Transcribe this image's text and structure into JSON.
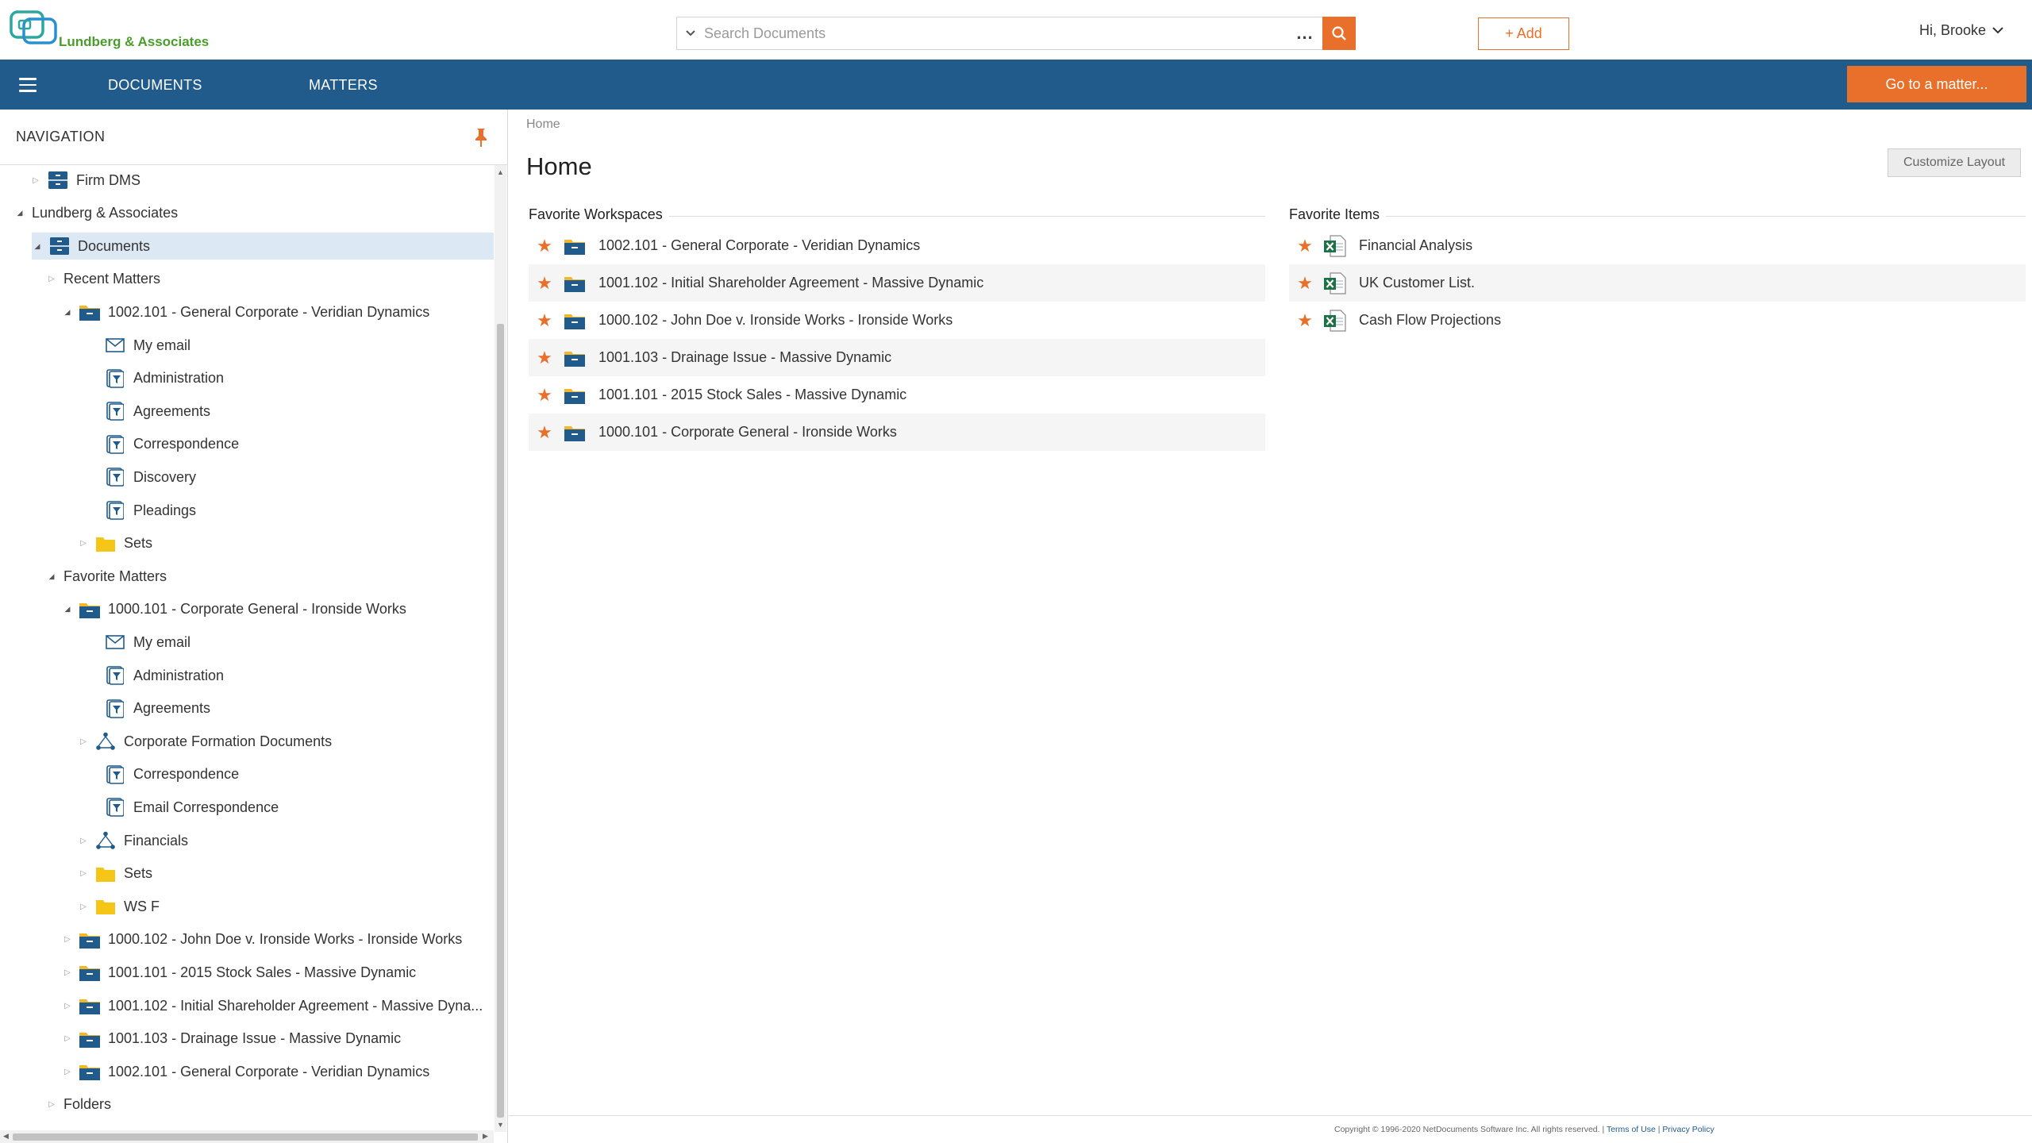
{
  "app": {
    "logo_text": "Lundberg & Associates",
    "accent": "#e8702a",
    "nav_color": "#215b8b"
  },
  "search": {
    "placeholder": "Search Documents",
    "more": "..."
  },
  "header": {
    "add_label": "+ Add",
    "user_greeting": "Hi, Brooke"
  },
  "navbar": {
    "documents": "DOCUMENTS",
    "matters": "MATTERS",
    "goto": "Go to a matter..."
  },
  "nav": {
    "title": "NAVIGATION",
    "tree": [
      {
        "label": "Firm DMS",
        "icon": "cabinet",
        "indent": 1,
        "toggle": "collapsed"
      },
      {
        "label": "Lundberg & Associates",
        "icon": "",
        "indent": 0,
        "toggle": "expanded"
      },
      {
        "label": "Documents",
        "icon": "cabinet",
        "indent": 1,
        "toggle": "expanded",
        "selected": true
      },
      {
        "label": "Recent Matters",
        "icon": "",
        "indent": 2,
        "toggle": "collapsed"
      },
      {
        "label": "1002.101 - General Corporate - Veridian Dynamics",
        "icon": "workspace",
        "indent": 3,
        "toggle": "expanded"
      },
      {
        "label": "My email",
        "icon": "email",
        "indent": 4,
        "toggle": ""
      },
      {
        "label": "Administration",
        "icon": "filter",
        "indent": 4,
        "toggle": ""
      },
      {
        "label": "Agreements",
        "icon": "filter",
        "indent": 4,
        "toggle": ""
      },
      {
        "label": "Correspondence",
        "icon": "filter",
        "indent": 4,
        "toggle": ""
      },
      {
        "label": "Discovery",
        "icon": "filter",
        "indent": 4,
        "toggle": ""
      },
      {
        "label": "Pleadings",
        "icon": "filter",
        "indent": 4,
        "toggle": ""
      },
      {
        "label": "Sets",
        "icon": "folder",
        "indent": 4,
        "toggle": "collapsed"
      },
      {
        "label": "Favorite Matters",
        "icon": "",
        "indent": 2,
        "toggle": "expanded"
      },
      {
        "label": "1000.101 - Corporate General - Ironside Works",
        "icon": "workspace",
        "indent": 3,
        "toggle": "expanded"
      },
      {
        "label": "My email",
        "icon": "email",
        "indent": 4,
        "toggle": ""
      },
      {
        "label": "Administration",
        "icon": "filter",
        "indent": 4,
        "toggle": ""
      },
      {
        "label": "Agreements",
        "icon": "filter",
        "indent": 4,
        "toggle": ""
      },
      {
        "label": "Corporate Formation Documents",
        "icon": "structure",
        "indent": 4,
        "toggle": "collapsed"
      },
      {
        "label": "Correspondence",
        "icon": "filter",
        "indent": 4,
        "toggle": ""
      },
      {
        "label": "Email Correspondence",
        "icon": "filter",
        "indent": 4,
        "toggle": ""
      },
      {
        "label": "Financials",
        "icon": "structure",
        "indent": 4,
        "toggle": "collapsed"
      },
      {
        "label": "Sets",
        "icon": "folder",
        "indent": 4,
        "toggle": "collapsed"
      },
      {
        "label": "WS F",
        "icon": "folder",
        "indent": 4,
        "toggle": "collapsed"
      },
      {
        "label": "1000.102 - John Doe v. Ironside Works - Ironside Works",
        "icon": "workspace",
        "indent": 3,
        "toggle": "collapsed"
      },
      {
        "label": "1001.101 - 2015 Stock Sales - Massive Dynamic",
        "icon": "workspace",
        "indent": 3,
        "toggle": "collapsed"
      },
      {
        "label": "1001.102 - Initial Shareholder Agreement - Massive Dyna...",
        "icon": "workspace",
        "indent": 3,
        "toggle": "collapsed"
      },
      {
        "label": "1001.103 - Drainage Issue - Massive Dynamic",
        "icon": "workspace",
        "indent": 3,
        "toggle": "collapsed"
      },
      {
        "label": "1002.101 - General Corporate - Veridian Dynamics",
        "icon": "workspace",
        "indent": 3,
        "toggle": "collapsed"
      },
      {
        "label": "Folders",
        "icon": "",
        "indent": 2,
        "toggle": "collapsed"
      }
    ]
  },
  "main": {
    "breadcrumb": "Home",
    "title": "Home",
    "customize": "Customize Layout",
    "favorite_workspaces": {
      "title": "Favorite Workspaces",
      "items": [
        "1002.101 - General Corporate - Veridian Dynamics",
        "1001.102 - Initial Shareholder Agreement - Massive Dynamic",
        "1000.102 - John Doe v. Ironside Works - Ironside Works",
        "1001.103 - Drainage Issue - Massive Dynamic",
        "1001.101 - 2015 Stock Sales - Massive Dynamic",
        "1000.101 - Corporate General - Ironside Works"
      ]
    },
    "favorite_items": {
      "title": "Favorite Items",
      "items": [
        "Financial Analysis",
        "UK Customer List.",
        "Cash Flow Projections"
      ]
    }
  },
  "footer": {
    "copyright": "Copyright © 1996-2020 NetDocuments Software Inc. All rights reserved. |",
    "terms": "Terms of Use",
    "sep": "|",
    "privacy": "Privacy Policy"
  }
}
